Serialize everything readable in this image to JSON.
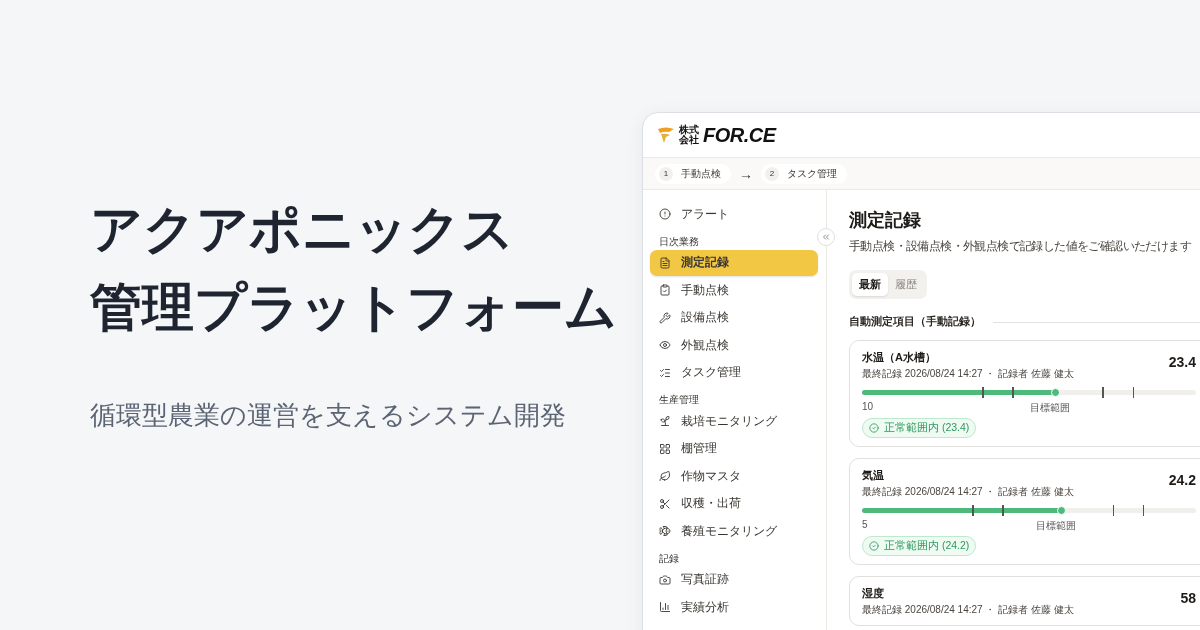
{
  "hero": {
    "title_lines": [
      "アクアポニックス",
      "管理プラットフォーム"
    ],
    "subtitle": "循環型農業の運営を支えるシステム開発"
  },
  "app": {
    "logo": {
      "small": [
        "株式",
        "会社"
      ],
      "name": "FOR.CE"
    },
    "breadcrumb": {
      "steps": [
        {
          "number": "1",
          "label": "手動点検"
        },
        {
          "number": "2",
          "label": "タスク管理"
        }
      ],
      "separator": "→"
    },
    "sidebar": {
      "groups": [
        {
          "items": [
            {
              "label": "アラート",
              "selected": false
            }
          ]
        },
        {
          "title": "日次業務",
          "items": [
            {
              "label": "測定記録",
              "selected": true
            },
            {
              "label": "手動点検",
              "selected": false
            },
            {
              "label": "設備点検",
              "selected": false
            },
            {
              "label": "外観点検",
              "selected": false
            },
            {
              "label": "タスク管理",
              "selected": false
            }
          ]
        },
        {
          "title": "生産管理",
          "items": [
            {
              "label": "栽培モニタリング",
              "selected": false
            },
            {
              "label": "棚管理",
              "selected": false
            },
            {
              "label": "作物マスタ",
              "selected": false
            },
            {
              "label": "収穫・出荷",
              "selected": false
            },
            {
              "label": "養殖モニタリング",
              "selected": false
            }
          ]
        },
        {
          "title": "記録",
          "items": [
            {
              "label": "写真証跡",
              "selected": false
            },
            {
              "label": "実績分析",
              "selected": false
            }
          ]
        }
      ]
    },
    "content": {
      "title": "測定記録",
      "description": "手動点検・設備点検・外観点検で記録した値をご確認いただけます",
      "tabs": [
        {
          "label": "最新",
          "selected": true
        },
        {
          "label": "履歴",
          "selected": false
        }
      ],
      "section_title": "自動測定項目（手動記録）",
      "cards": [
        {
          "name": "水温（A水槽）",
          "meta": "最終記録 2026/08/24 14:27 ・ 記録者 佐藤 健太",
          "value": "23.4",
          "level": 0.58,
          "scale_min": "10",
          "range_label": "目標範囲",
          "status": {
            "kind": "normal",
            "label": "正常範囲内 (23.4)"
          }
        },
        {
          "name": "気温",
          "meta": "最終記録 2026/08/24 14:27 ・ 記録者 佐藤 健太",
          "value": "24.2",
          "level": 0.6,
          "scale_min": "5",
          "range_label": "目標範囲",
          "status": {
            "kind": "normal",
            "label": "正常範囲内 (24.2)"
          }
        },
        {
          "name": "湿度",
          "meta": "最終記録 2026/08/24 14:27 ・ 記録者 佐藤 健太",
          "value": "58"
        }
      ]
    }
  }
}
